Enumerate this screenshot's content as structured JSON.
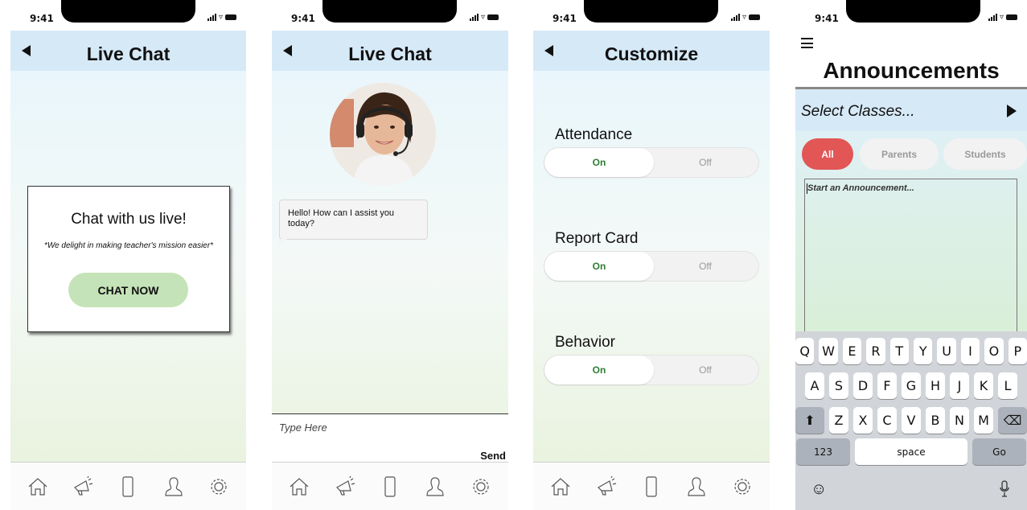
{
  "status": {
    "time": "9:41"
  },
  "screens": {
    "live_chat_intro": {
      "title": "Live Chat",
      "card_title": "Chat with us live!",
      "card_subtitle": "*We delight in making teacher's mission easier*",
      "chat_button": "CHAT NOW"
    },
    "live_chat_conversation": {
      "title": "Live Chat",
      "message": "Hello! How can I assist you today?",
      "input_placeholder": "Type Here",
      "send_label": "Send"
    },
    "customize": {
      "title": "Customize",
      "settings": [
        {
          "label": "Attendance",
          "on": "On",
          "off": "Off",
          "selected": "On"
        },
        {
          "label": "Report Card",
          "on": "On",
          "off": "Off",
          "selected": "On"
        },
        {
          "label": "Behavior",
          "on": "On",
          "off": "Off",
          "selected": "On"
        }
      ]
    },
    "announcements": {
      "title": "Announcements",
      "select_classes": "Select Classes...",
      "audience": [
        "All",
        "Parents",
        "Students"
      ],
      "audience_selected": "All",
      "placeholder": "Start an Announcement...",
      "keyboard": {
        "row1": [
          "Q",
          "W",
          "E",
          "R",
          "T",
          "Y",
          "U",
          "I",
          "O",
          "P"
        ],
        "row2": [
          "A",
          "S",
          "D",
          "F",
          "G",
          "H",
          "J",
          "K",
          "L"
        ],
        "row3": [
          "Z",
          "X",
          "C",
          "V",
          "B",
          "N",
          "M"
        ],
        "numbers": "123",
        "space": "space",
        "go": "Go"
      }
    }
  },
  "tabbar_icons": [
    "home-icon",
    "megaphone-icon",
    "phone-device-icon",
    "profile-icon",
    "settings-gear-icon"
  ],
  "colors": {
    "header_bg": "#d6e9f7",
    "chat_button": "#c5e3b8",
    "toggle_on_text": "#2e7d32",
    "all_pill": "#e25656",
    "keyboard_bg": "#d1d4d9"
  }
}
